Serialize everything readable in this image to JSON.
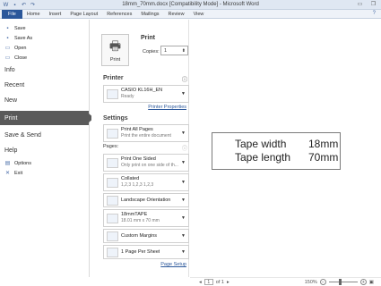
{
  "window": {
    "title": "18mm_70mm.docx [Compatibility Mode] - Microsoft Word"
  },
  "ribbon": {
    "tabs": [
      "File",
      "Home",
      "Insert",
      "Page Layout",
      "References",
      "Mailings",
      "Review",
      "View"
    ]
  },
  "backstage": {
    "top_items": [
      {
        "label": "Save",
        "icon": "save-icon"
      },
      {
        "label": "Save As",
        "icon": "save-as-icon"
      },
      {
        "label": "Open",
        "icon": "open-folder-icon"
      },
      {
        "label": "Close",
        "icon": "close-doc-icon"
      }
    ],
    "info": "Info",
    "recent": "Recent",
    "new": "New",
    "print": "Print",
    "save_send": "Save & Send",
    "help": "Help",
    "options": "Options",
    "exit": "Exit"
  },
  "print": {
    "heading": "Print",
    "button_label": "Print",
    "copies_label": "Copies:",
    "copies_value": "1",
    "printer_title": "Printer",
    "printer_name": "CASIO KL16H_EN",
    "printer_status": "Ready",
    "printer_properties": "Printer Properties",
    "settings_title": "Settings",
    "print_all_main": "Print All Pages",
    "print_all_sub": "Print the entire document",
    "pages_label": "Pages:",
    "one_sided_main": "Print One Sided",
    "one_sided_sub": "Only print on one side of th...",
    "collated_main": "Collated",
    "collated_sub": "1,2,3   1,2,3   1,2,3",
    "orientation_main": "Landscape Orientation",
    "paper_main": "18mmTAPE",
    "paper_sub": "18.01 mm x 70 mm",
    "margins_main": "Custom Margins",
    "per_sheet_main": "1 Page Per Sheet",
    "page_setup": "Page Setup"
  },
  "preview": {
    "line1_key": "Tape width",
    "line1_val": "18mm",
    "line2_key": "Tape length",
    "line2_val": "70mm"
  },
  "status": {
    "page_current": "1",
    "page_of": "of 1",
    "zoom": "150%"
  }
}
